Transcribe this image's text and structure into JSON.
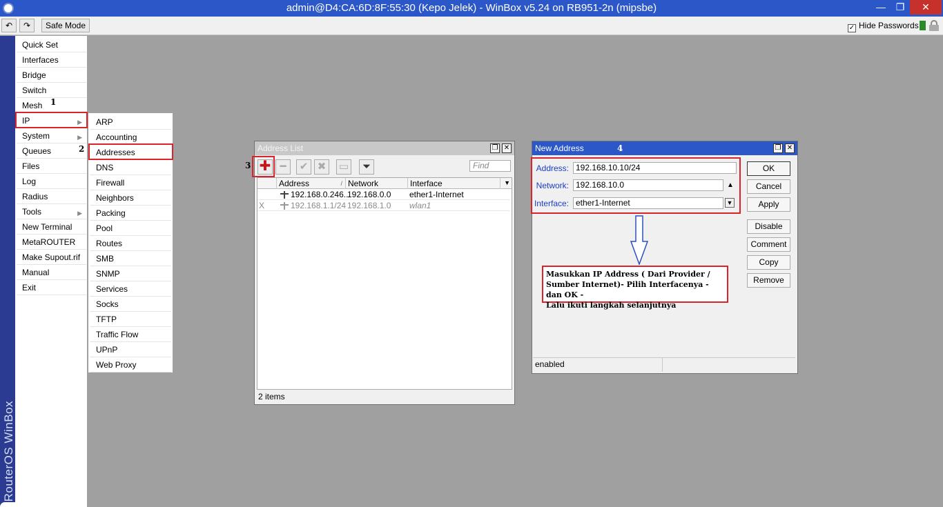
{
  "window": {
    "title": "admin@D4:CA:6D:8F:55:30 (Kepo Jelek) - WinBox v5.24 on RB951-2n (mipsbe)",
    "min_glyph": "—",
    "max_glyph": "❐",
    "close_glyph": "✕"
  },
  "toolbar": {
    "undo_glyph": "↶",
    "redo_glyph": "↷",
    "safe_mode_label": "Safe Mode",
    "hide_passwords_label": "Hide Passwords",
    "hide_passwords_checked": "✓"
  },
  "brand": {
    "text": "RouterOS WinBox"
  },
  "main_menu": {
    "items": [
      {
        "label": "Quick Set",
        "submenu": false
      },
      {
        "label": "Interfaces",
        "submenu": false
      },
      {
        "label": "Bridge",
        "submenu": false
      },
      {
        "label": "Switch",
        "submenu": false
      },
      {
        "label": "Mesh",
        "submenu": false
      },
      {
        "label": "IP",
        "submenu": true
      },
      {
        "label": "System",
        "submenu": true
      },
      {
        "label": "Queues",
        "submenu": false
      },
      {
        "label": "Files",
        "submenu": false
      },
      {
        "label": "Log",
        "submenu": false
      },
      {
        "label": "Radius",
        "submenu": false
      },
      {
        "label": "Tools",
        "submenu": true
      },
      {
        "label": "New Terminal",
        "submenu": false
      },
      {
        "label": "MetaROUTER",
        "submenu": false
      },
      {
        "label": "Make Supout.rif",
        "submenu": false
      },
      {
        "label": "Manual",
        "submenu": false
      },
      {
        "label": "Exit",
        "submenu": false
      }
    ],
    "arrow_glyph": "▶"
  },
  "ip_submenu": {
    "items": [
      "ARP",
      "Accounting",
      "Addresses",
      "DNS",
      "Firewall",
      "Neighbors",
      "Packing",
      "Pool",
      "Routes",
      "SMB",
      "SNMP",
      "Services",
      "Socks",
      "TFTP",
      "Traffic Flow",
      "UPnP",
      "Web Proxy"
    ]
  },
  "annotations": {
    "step1": "1",
    "step2": "2",
    "step3": "3",
    "step4": "4",
    "note_line1": "Masukkan IP Address ( Dari Provider /",
    "note_line2": "Sumber Internet)- Pilih Interfacenya - dan OK -",
    "note_line3": "Lalu ikuti langkah selanjutnya"
  },
  "address_list": {
    "title": "Address List",
    "add_glyph": "✚",
    "remove_glyph": "━",
    "enable_glyph": "✔",
    "disable_glyph": "✖",
    "comment_glyph": "▭",
    "filter_glyph": "⏷",
    "find_placeholder": "Find",
    "columns": {
      "address": "Address",
      "network": "Network",
      "interface": "Interface"
    },
    "sort_glyph": "/",
    "dropdown_glyph": "▼",
    "rows": [
      {
        "flag": "",
        "address": "192.168.0.246...",
        "network": "192.168.0.0",
        "interface": "ether1-Internet"
      },
      {
        "flag": "X",
        "address": "192.168.1.1/24",
        "network": "192.168.1.0",
        "interface": "wlan1"
      }
    ],
    "status": "2 items",
    "restore_glyph": "❐",
    "close_glyph": "✕"
  },
  "new_address": {
    "title": "New Address",
    "labels": {
      "address": "Address:",
      "network": "Network:",
      "interface": "Interface:"
    },
    "values": {
      "address": "192.168.10.10/24",
      "network": "192.168.10.0",
      "interface": "ether1-Internet"
    },
    "up_glyph": "▲",
    "dd_glyph": "▼",
    "buttons": {
      "ok": "OK",
      "cancel": "Cancel",
      "apply": "Apply",
      "disable": "Disable",
      "comment": "Comment",
      "copy": "Copy",
      "remove": "Remove"
    },
    "status": "enabled",
    "restore_glyph": "❐",
    "close_glyph": "✕"
  }
}
